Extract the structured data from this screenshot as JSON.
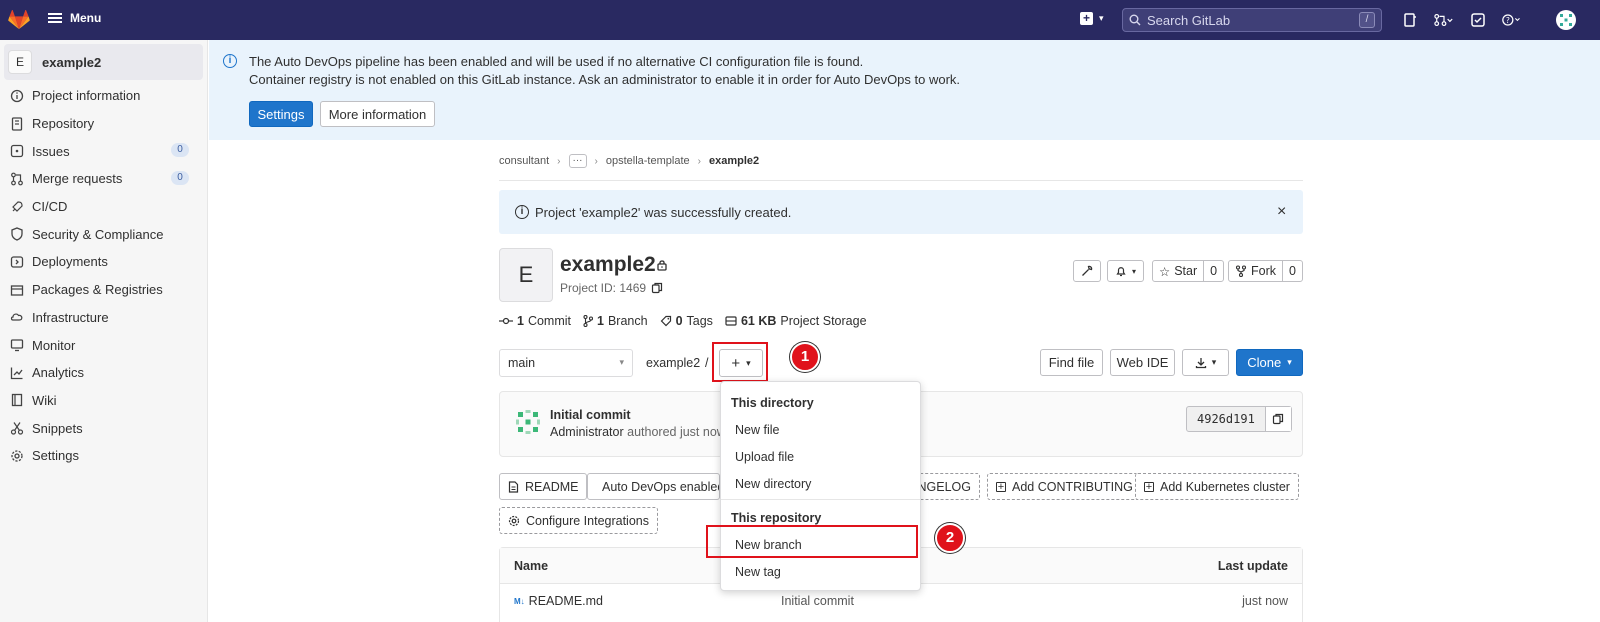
{
  "topbar": {
    "menu_label": "Menu",
    "search_placeholder": "Search GitLab",
    "search_shortcut": "/",
    "icons": [
      "plus-square-icon",
      "todo-icon",
      "merge-request-icon",
      "issues-icon",
      "help-icon",
      "avatar"
    ]
  },
  "sidebar": {
    "project_initial": "E",
    "project_name": "example2",
    "items": [
      {
        "label": "Project information",
        "icon": "info-icon"
      },
      {
        "label": "Repository",
        "icon": "repository-icon"
      },
      {
        "label": "Issues",
        "icon": "issues-icon",
        "badge": "0"
      },
      {
        "label": "Merge requests",
        "icon": "merge-request-icon",
        "badge": "0"
      },
      {
        "label": "CI/CD",
        "icon": "rocket-icon"
      },
      {
        "label": "Security & Compliance",
        "icon": "shield-icon"
      },
      {
        "label": "Deployments",
        "icon": "deployments-icon"
      },
      {
        "label": "Packages & Registries",
        "icon": "package-icon"
      },
      {
        "label": "Infrastructure",
        "icon": "cloud-icon"
      },
      {
        "label": "Monitor",
        "icon": "monitor-icon"
      },
      {
        "label": "Analytics",
        "icon": "chart-icon"
      },
      {
        "label": "Wiki",
        "icon": "book-icon"
      },
      {
        "label": "Snippets",
        "icon": "scissors-icon"
      },
      {
        "label": "Settings",
        "icon": "gear-icon"
      }
    ]
  },
  "devops_banner": {
    "line1": "The Auto DevOps pipeline has been enabled and will be used if no alternative CI configuration file is found.",
    "line2": "Container registry is not enabled on this GitLab instance. Ask an administrator to enable it in order for Auto DevOps to work.",
    "settings_label": "Settings",
    "more_info_label": "More information"
  },
  "breadcrumb": {
    "items": [
      "consultant",
      "···",
      "opstella-template",
      "example2"
    ]
  },
  "alert": {
    "message": "Project 'example2' was successfully created.",
    "close": "×"
  },
  "project": {
    "initial": "E",
    "name": "example2",
    "id_text": "Project ID: 1469",
    "star_label": "Star",
    "star_count": "0",
    "fork_label": "Fork",
    "fork_count": "0"
  },
  "stats": {
    "commits_count": "1",
    "commits_label": "Commit",
    "branches_count": "1",
    "branches_label": "Branch",
    "tags_count": "0",
    "tags_label": "Tags",
    "storage_size": "61 KB",
    "storage_label": "Project Storage"
  },
  "repo_bar": {
    "branch": "main",
    "path": "example2",
    "path_sep": "/",
    "add_label": "+",
    "find_file_label": "Find file",
    "web_ide_label": "Web IDE",
    "clone_label": "Clone"
  },
  "commit": {
    "title": "Initial commit",
    "author": "Administrator",
    "meta": "authored just now",
    "sha": "4926d191"
  },
  "quick_actions": {
    "readme": "README",
    "auto_devops": "Auto DevOps enabled",
    "changelog": "ANGELOG",
    "contributing": "Add CONTRIBUTING",
    "kubernetes": "Add Kubernetes cluster",
    "integrations": "Configure Integrations"
  },
  "files": {
    "col_name": "Name",
    "col_update": "Last update",
    "rows": [
      {
        "name": "README.md",
        "commit": "Initial commit",
        "updated": "just now"
      }
    ]
  },
  "dropdown": {
    "section1": "This directory",
    "new_file": "New file",
    "upload_file": "Upload file",
    "new_directory": "New directory",
    "section2": "This repository",
    "new_branch": "New branch",
    "new_tag": "New tag"
  },
  "annotations": {
    "step1": "1",
    "step2": "2"
  },
  "colors": {
    "topbar": "#292961",
    "primary": "#1f75cb",
    "annotation_red": "#e0121b",
    "banner_bg": "#e9f3fc"
  }
}
